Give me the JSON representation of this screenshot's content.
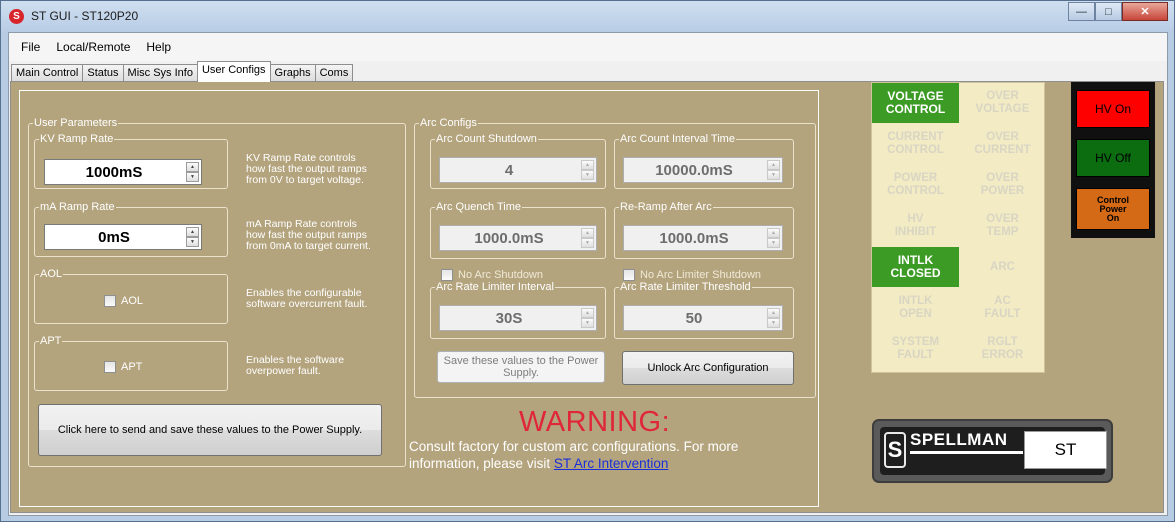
{
  "window": {
    "title": "ST GUI - ST120P20",
    "icon": "spellman-s-icon",
    "controls": [
      "minimize",
      "maximize",
      "close"
    ]
  },
  "menu": [
    "File",
    "Local/Remote",
    "Help"
  ],
  "tabs": [
    "Main Control",
    "Status",
    "Misc Sys Info",
    "User Configs",
    "Graphs",
    "Coms"
  ],
  "active_tab": "User Configs",
  "user_params": {
    "legend": "User Parameters",
    "kv_ramp": {
      "legend": "KV Ramp Rate",
      "value": "1000mS",
      "desc": [
        "KV Ramp Rate controls",
        "how fast the output ramps",
        "from 0V to target voltage."
      ]
    },
    "ma_ramp": {
      "legend": "mA Ramp Rate",
      "value": "0mS",
      "desc": [
        "mA Ramp Rate controls",
        "how fast the output ramps",
        "from 0mA to target current."
      ]
    },
    "aol": {
      "legend": "AOL",
      "checkbox": "AOL",
      "checked": false,
      "desc": [
        "Enables the configurable",
        "software overcurrent fault."
      ]
    },
    "apt": {
      "legend": "APT",
      "checkbox": "APT",
      "checked": false,
      "desc": [
        "Enables the software",
        "overpower fault."
      ]
    },
    "send_button": "Click here to send and save these values to the Power Supply."
  },
  "arc_configs": {
    "legend": "Arc Configs",
    "arc_count_shutdown": {
      "legend": "Arc Count Shutdown",
      "value": "4"
    },
    "arc_count_interval": {
      "legend": "Arc Count Interval Time",
      "value": "10000.0mS"
    },
    "arc_quench_time": {
      "legend": "Arc Quench Time",
      "value": "1000.0mS"
    },
    "re_ramp": {
      "legend": "Re-Ramp After Arc",
      "value": "1000.0mS"
    },
    "no_arc_shutdown": "No Arc Shutdown",
    "no_arc_limiter_shutdown": "No Arc Limiter Shutdown",
    "arc_rate_interval": {
      "legend": "Arc Rate Limiter Interval",
      "value": "30S"
    },
    "arc_rate_threshold": {
      "legend": "Arc Rate Limiter Threshold",
      "value": "50"
    },
    "save_button": [
      "Save these values to the Power",
      "Supply."
    ],
    "unlock_button": "Unlock Arc Configuration"
  },
  "warning": {
    "title": "WARNING:",
    "line1": "Consult factory for custom arc configurations. For more",
    "line2_prefix": "information, please visit ",
    "link": "ST Arc Intervention"
  },
  "status": [
    {
      "label": [
        "VOLTAGE",
        "CONTROL"
      ],
      "active": true
    },
    {
      "label": [
        "OVER",
        "VOLTAGE"
      ],
      "active": false
    },
    {
      "label": [
        "CURRENT",
        "CONTROL"
      ],
      "active": false
    },
    {
      "label": [
        "OVER",
        "CURRENT"
      ],
      "active": false
    },
    {
      "label": [
        "POWER",
        "CONTROL"
      ],
      "active": false
    },
    {
      "label": [
        "OVER",
        "POWER"
      ],
      "active": false
    },
    {
      "label": [
        "HV",
        "INHIBIT"
      ],
      "active": false
    },
    {
      "label": [
        "OVER",
        "TEMP"
      ],
      "active": false
    },
    {
      "label": [
        "INTLK",
        "CLOSED"
      ],
      "active": true
    },
    {
      "label": [
        "ARC",
        ""
      ],
      "active": false
    },
    {
      "label": [
        "INTLK",
        "OPEN"
      ],
      "active": false
    },
    {
      "label": [
        "AC",
        "FAULT"
      ],
      "active": false
    },
    {
      "label": [
        "SYSTEM",
        "FAULT"
      ],
      "active": false
    },
    {
      "label": [
        "RGLT",
        "ERROR"
      ],
      "active": false
    }
  ],
  "hv": {
    "on": "HV On",
    "off": "HV Off",
    "control_power": [
      "Control",
      "Power",
      "On"
    ]
  },
  "logo": {
    "brand": "SPELLMAN",
    "model": "ST",
    "s": "S"
  },
  "colors": {
    "panel": "#b4a47e",
    "status_on": "#3c9b25",
    "status_bg": "#f2ebc4",
    "hv_on": "#ff0000",
    "hv_off": "#0c6c10",
    "control_power": "#d56a16",
    "warning": "#e0263b"
  }
}
